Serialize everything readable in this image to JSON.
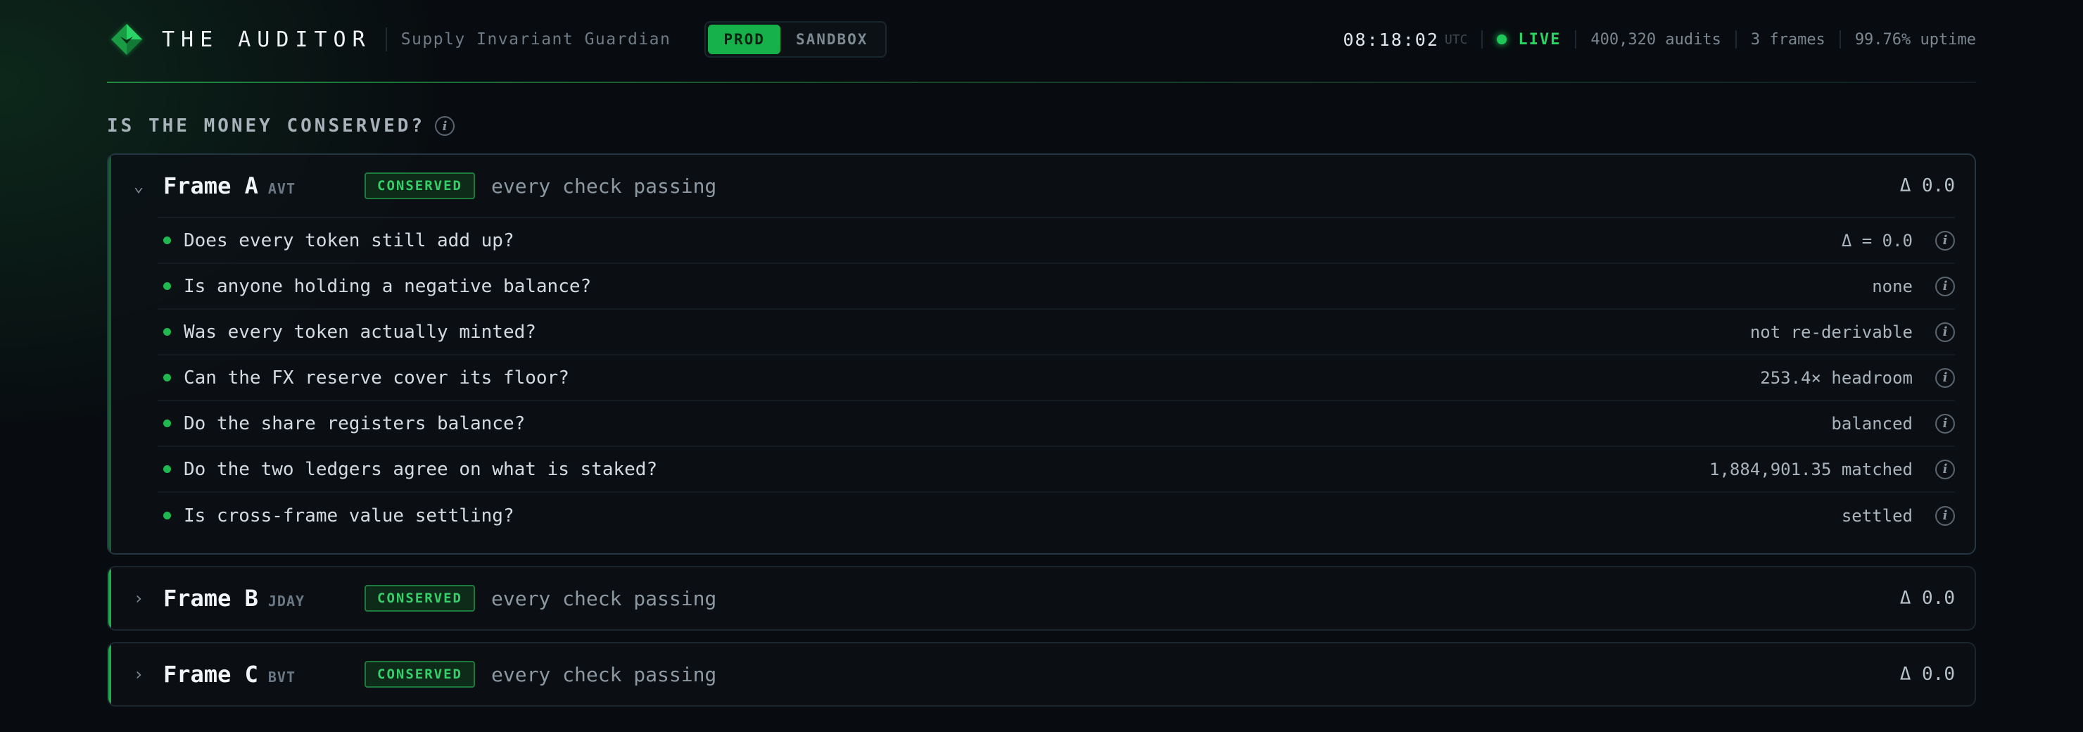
{
  "header": {
    "brand": "THE AUDITOR",
    "subtitle": "Supply Invariant Guardian",
    "env": {
      "prod": "PROD",
      "sandbox": "SANDBOX",
      "active": "PROD"
    },
    "clock": "08:18:02",
    "tz": "UTC",
    "live": "LIVE",
    "audits": "400,320 audits",
    "frames": "3 frames",
    "uptime": "99.76% uptime"
  },
  "colors": {
    "accent": "#17b14c",
    "live": "#1ec95a",
    "background": "#080c10"
  },
  "section": {
    "title": "IS THE MONEY CONSERVED?",
    "info": "i"
  },
  "frames": [
    {
      "name": "Frame A",
      "ticker": "AVT",
      "badge": "CONSERVED",
      "desc": "every check passing",
      "delta": "Δ 0.0",
      "expanded": true,
      "chevron": "⌄",
      "checks": [
        {
          "q": "Does every token still add up?",
          "v": "Δ = 0.0"
        },
        {
          "q": "Is anyone holding a negative balance?",
          "v": "none"
        },
        {
          "q": "Was every token actually minted?",
          "v": "not re-derivable"
        },
        {
          "q": "Can the FX reserve cover its floor?",
          "v": "253.4× headroom"
        },
        {
          "q": "Do the share registers balance?",
          "v": "balanced"
        },
        {
          "q": "Do the two ledgers agree on what is staked?",
          "v": "1,884,901.35 matched"
        },
        {
          "q": "Is cross-frame value settling?",
          "v": "settled"
        }
      ]
    },
    {
      "name": "Frame B",
      "ticker": "JDAY",
      "badge": "CONSERVED",
      "desc": "every check passing",
      "delta": "Δ 0.0",
      "expanded": false,
      "chevron": "›"
    },
    {
      "name": "Frame C",
      "ticker": "BVT",
      "badge": "CONSERVED",
      "desc": "every check passing",
      "delta": "Δ 0.0",
      "expanded": false,
      "chevron": "›"
    }
  ]
}
